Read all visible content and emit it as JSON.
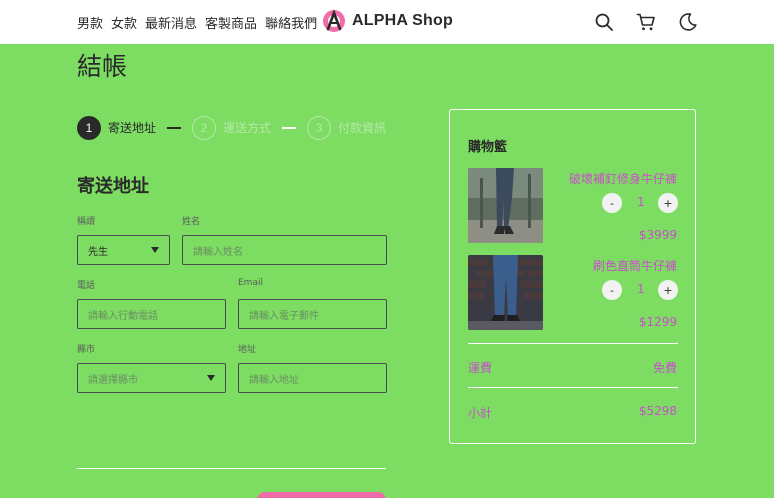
{
  "nav": {
    "items": [
      "男款",
      "女款",
      "最新消息",
      "客製商品",
      "聯絡我們"
    ]
  },
  "brand": {
    "name": "ALPHA Shop"
  },
  "icons": {
    "search": "search-icon",
    "cart": "cart-icon",
    "theme": "moon-icon"
  },
  "page": {
    "title": "結帳"
  },
  "steps": [
    {
      "number": "1",
      "label": "寄送地址"
    },
    {
      "number": "2",
      "label": "運送方式"
    },
    {
      "number": "3",
      "label": "付款資訊"
    }
  ],
  "form": {
    "section_title": "寄送地址",
    "salutation": {
      "label": "稱謂",
      "value": "先生"
    },
    "name": {
      "label": "姓名",
      "placeholder": "請輸入姓名"
    },
    "phone": {
      "label": "電話",
      "placeholder": "請輸入行動電話"
    },
    "email": {
      "label": "Email",
      "placeholder": "請輸入電子郵件"
    },
    "city": {
      "label": "縣市",
      "placeholder": "請選擇縣市"
    },
    "address": {
      "label": "地址",
      "placeholder": "請輸入地址"
    }
  },
  "cart": {
    "title": "購物籃",
    "items": [
      {
        "name": "破壞補釘修身牛仔褲",
        "quantity": "1",
        "price": "$3999",
        "minus": "-",
        "plus": "+"
      },
      {
        "name": "刷色直筒牛仔褲",
        "quantity": "1",
        "price": "$1299",
        "minus": "-",
        "plus": "+"
      }
    ],
    "shipping": {
      "label": "運費",
      "value": "免費"
    },
    "subtotal": {
      "label": "小計",
      "value": "$5298"
    }
  },
  "colors": {
    "background": "#7ddd63",
    "accent": "#c850c8",
    "button": "#f06ba8",
    "dark": "#2a2a2a"
  }
}
